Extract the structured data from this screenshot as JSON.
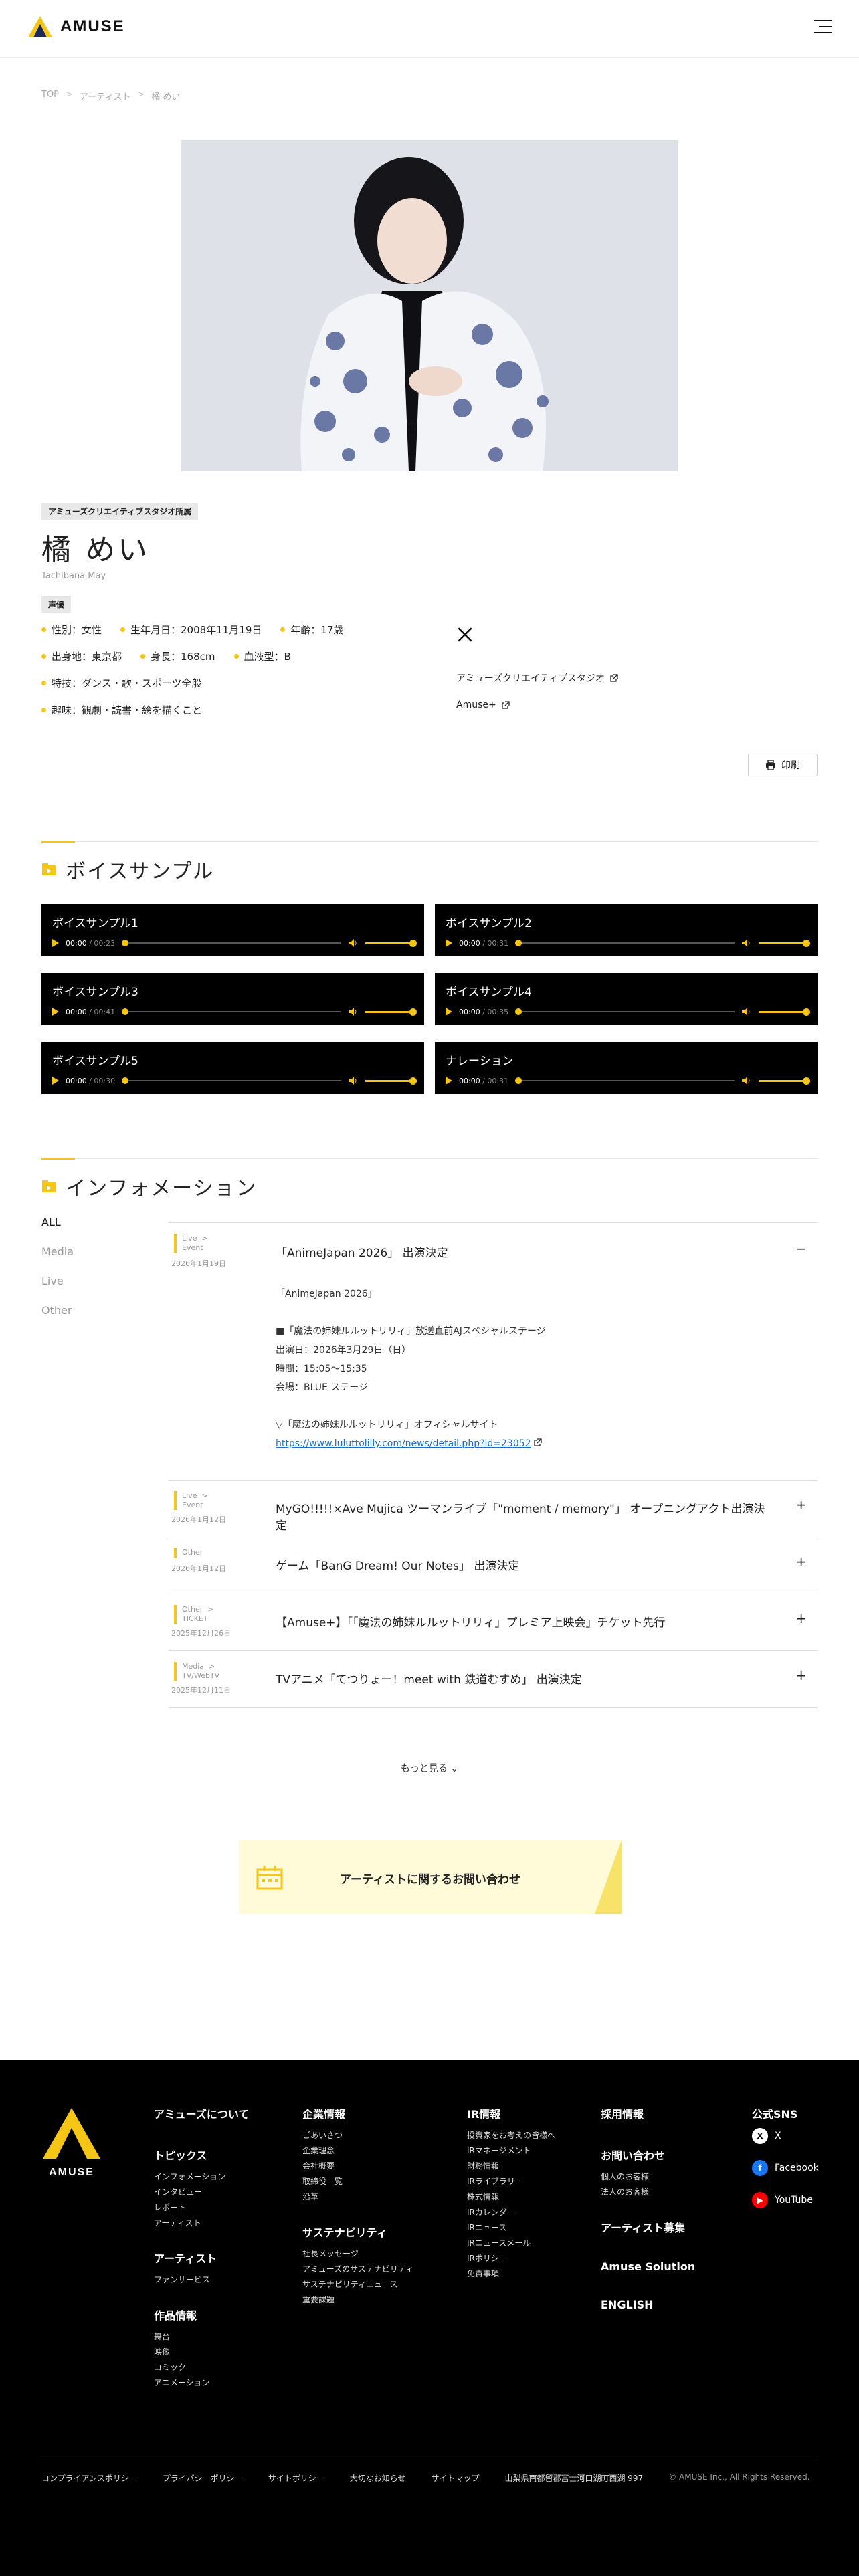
{
  "header": {
    "logo_text": "AMUSE"
  },
  "breadcrumb": [
    "TOP",
    "アーティスト",
    "橘 めい"
  ],
  "artist": {
    "agency_tag": "アミューズクリエイティブスタジオ所属",
    "name_ja": "橘 めい",
    "name_en": "Tachibana May",
    "role_tag": "声優",
    "profile_rows": [
      [
        "性別：女性",
        "生年月日：2008年11月19日",
        "年齢：17歳"
      ],
      [
        "出身地：東京都",
        "身長：168cm",
        "血液型：B"
      ],
      [
        "特技：ダンス・歌・スポーツ全般"
      ],
      [
        "趣味：観劇・読書・絵を描くこと"
      ]
    ],
    "links": [
      "アミューズクリエイティブスタジオ",
      "Amuse+"
    ],
    "print_label": "印刷"
  },
  "voice": {
    "title": "ボイスサンプル",
    "samples": [
      {
        "title": "ボイスサンプル1",
        "current": "00:00",
        "total": "00:23"
      },
      {
        "title": "ボイスサンプル2",
        "current": "00:00",
        "total": "00:31"
      },
      {
        "title": "ボイスサンプル3",
        "current": "00:00",
        "total": "00:41"
      },
      {
        "title": "ボイスサンプル4",
        "current": "00:00",
        "total": "00:35"
      },
      {
        "title": "ボイスサンプル5",
        "current": "00:00",
        "total": "00:30"
      },
      {
        "title": "ナレーション",
        "current": "00:00",
        "total": "00:31"
      }
    ]
  },
  "info": {
    "title": "インフォメーション",
    "filters": [
      "ALL",
      "Media",
      "Live",
      "Other"
    ],
    "items": [
      {
        "cats": [
          "Live",
          "Event"
        ],
        "date": "2026年1月19日",
        "title": "「AnimeJapan 2026」 出演決定",
        "toggle": "−",
        "body": [
          "「AnimeJapan 2026」",
          "",
          "■「魔法の姉妹ルルットリリィ」放送直前AJスペシャルステージ",
          "出演日：2026年3月29日（日）",
          "時間：15:05〜15:35",
          "会場：BLUE ステージ",
          "",
          "▽「魔法の姉妹ルルットリリィ」オフィシャルサイト"
        ],
        "link": "https://www.luluttolilly.com/news/detail.php?id=23052"
      },
      {
        "cats": [
          "Live",
          "Event"
        ],
        "date": "2026年1月12日",
        "title": "MyGO!!!!!×Ave Mujica ツーマンライブ「\"moment / memory\"」 オープニングアクト出演決定",
        "toggle": "+"
      },
      {
        "cats": [
          "Other"
        ],
        "date": "2026年1月12日",
        "title": "ゲーム「BanG Dream! Our Notes」 出演決定",
        "toggle": "+"
      },
      {
        "cats": [
          "Other",
          "TICKET"
        ],
        "date": "2025年12月26日",
        "title": "【Amuse+】「「魔法の姉妹ルルットリリィ」プレミア上映会」チケット先行",
        "toggle": "+"
      },
      {
        "cats": [
          "Media",
          "TV/WebTV"
        ],
        "date": "2025年12月11日",
        "title": "TVアニメ「てつりょー！meet with 鉄道むすめ」 出演決定",
        "toggle": "+"
      }
    ],
    "more_label": "もっと見る"
  },
  "inquiry_label": "アーティストに関するお問い合わせ",
  "footer": {
    "logo_text": "AMUSE",
    "col1": [
      {
        "head": "アミューズについて",
        "subs": []
      },
      {
        "head": "トピックス",
        "subs": [
          "インフォメーション",
          "インタビュー",
          "レポート",
          "アーティスト"
        ]
      },
      {
        "head": "アーティスト",
        "subs": [
          "ファンサービス"
        ]
      },
      {
        "head": "作品情報",
        "subs": [
          "舞台",
          "映像",
          "コミック",
          "アニメーション"
        ]
      }
    ],
    "col2": [
      {
        "head": "企業情報",
        "subs": [
          "ごあいさつ",
          "企業理念",
          "会社概要",
          "取締役一覧",
          "沿革"
        ]
      },
      {
        "head": "サステナビリティ",
        "subs": [
          "社長メッセージ",
          "アミューズのサステナビリティ",
          "サステナビリティニュース",
          "重要課題"
        ]
      }
    ],
    "col3": [
      {
        "head": "IR情報",
        "subs": [
          "投資家をお考えの皆様へ",
          "IRマネージメント",
          "財務情報",
          "IRライブラリー",
          "株式情報",
          "IRカレンダー",
          "IRニュース",
          "IRニュースメール",
          "IRポリシー",
          "免責事項"
        ]
      }
    ],
    "col4": [
      {
        "head": "採用情報",
        "subs": []
      },
      {
        "head": "お問い合わせ",
        "subs": [
          "個人のお客様",
          "法人のお客様"
        ]
      },
      {
        "head": "アーティスト募集",
        "subs": []
      },
      {
        "head": "Amuse Solution",
        "subs": []
      },
      {
        "head": "ENGLISH",
        "subs": []
      }
    ],
    "sns_title": "公式SNS",
    "sns": [
      "X",
      "Facebook",
      "YouTube"
    ],
    "bottom_links": [
      "コンプライアンスポリシー",
      "プライバシーポリシー",
      "サイトポリシー",
      "大切なお知らせ",
      "サイトマップ"
    ],
    "address": "山梨県南都留郡富士河口湖町西湖 997",
    "copyright": "© AMUSE Inc., All Rights Reserved."
  }
}
